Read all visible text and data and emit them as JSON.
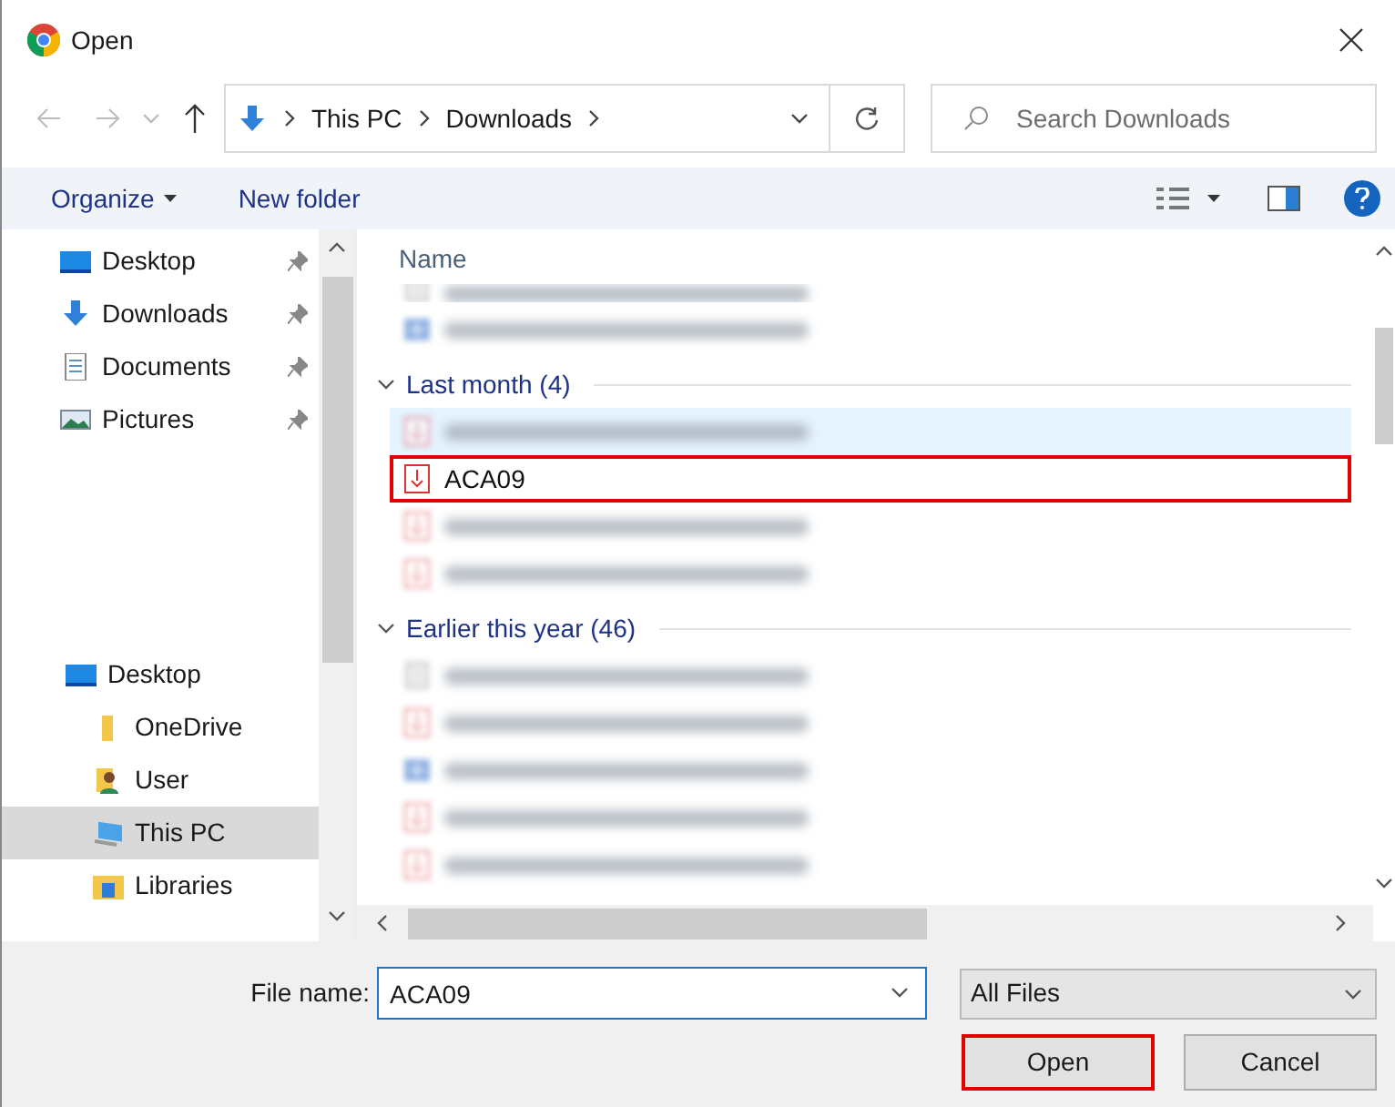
{
  "window": {
    "title": "Open"
  },
  "address": {
    "path": [
      "This PC",
      "Downloads"
    ],
    "search_placeholder": "Search Downloads"
  },
  "toolbar": {
    "organize": "Organize",
    "new_folder": "New folder"
  },
  "sidebar": {
    "quick_access": [
      {
        "label": "Desktop",
        "pinned": true,
        "selected": false
      },
      {
        "label": "Downloads",
        "pinned": true,
        "selected": false
      },
      {
        "label": "Documents",
        "pinned": true,
        "selected": false
      },
      {
        "label": "Pictures",
        "pinned": true,
        "selected": false
      }
    ],
    "tree": [
      {
        "label": "Desktop",
        "selected": false,
        "children": [
          {
            "label": "OneDrive",
            "selected": false
          },
          {
            "label": "User",
            "selected": false
          },
          {
            "label": "This PC",
            "selected": true
          },
          {
            "label": "Libraries",
            "selected": false
          }
        ]
      }
    ]
  },
  "file_list": {
    "column": "Name",
    "items": [
      {
        "kind": "redacted",
        "partial": true,
        "selected": false,
        "highlighted": false
      },
      {
        "kind": "redacted",
        "partial": false,
        "selected": false,
        "highlighted": false
      },
      {
        "kind": "group",
        "label": "Last month (4)",
        "expanded": true
      },
      {
        "kind": "redacted",
        "partial": false,
        "selected": true,
        "highlighted": false
      },
      {
        "kind": "file",
        "label": "ACA09",
        "selected": false,
        "highlighted": true
      },
      {
        "kind": "redacted",
        "partial": false,
        "selected": false,
        "highlighted": false
      },
      {
        "kind": "redacted",
        "partial": false,
        "selected": false,
        "highlighted": false
      },
      {
        "kind": "group",
        "label": "Earlier this year (46)",
        "expanded": true
      },
      {
        "kind": "redacted",
        "partial": false,
        "selected": false,
        "highlighted": false
      },
      {
        "kind": "redacted",
        "partial": false,
        "selected": false,
        "highlighted": false
      },
      {
        "kind": "redacted",
        "partial": false,
        "selected": false,
        "highlighted": false
      },
      {
        "kind": "redacted",
        "partial": false,
        "selected": false,
        "highlighted": false
      },
      {
        "kind": "redacted",
        "partial": false,
        "selected": false,
        "highlighted": false
      }
    ]
  },
  "footer": {
    "file_name_label": "File name:",
    "file_name": "ACA09",
    "file_type": "All Files",
    "buttons": [
      {
        "label": "Open",
        "highlighted": true
      },
      {
        "label": "Cancel",
        "highlighted": false
      }
    ]
  }
}
